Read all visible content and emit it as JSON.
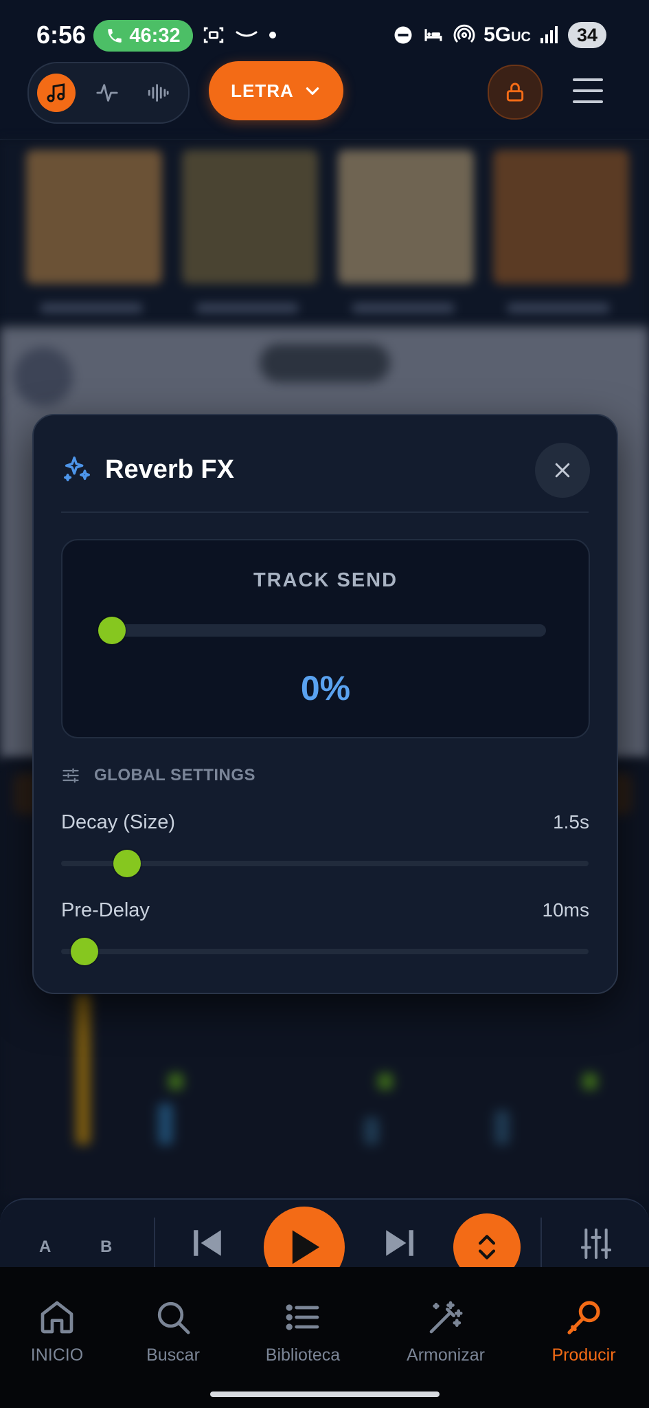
{
  "status_bar": {
    "time": "6:56",
    "call_timer": "46:32",
    "network": "5G",
    "network_suffix": "UC",
    "battery": "34"
  },
  "header": {
    "lyrics_button": "LETRA",
    "modes": [
      "music-note-icon",
      "waveform-line-icon",
      "audio-bars-icon"
    ],
    "active_mode": 0
  },
  "modal": {
    "title": "Reverb FX",
    "track_send": {
      "label": "TRACK SEND",
      "value_text": "0%",
      "level": 0
    },
    "global_settings": {
      "label": "GLOBAL SETTINGS",
      "params": [
        {
          "name": "Decay (Size)",
          "value_text": "1.5s",
          "level": 0.125
        },
        {
          "name": "Pre-Delay",
          "value_text": "10ms",
          "level": 0.045
        }
      ]
    }
  },
  "transport": {
    "a_label": "A",
    "b_label": "B"
  },
  "bottom_nav": {
    "items": [
      {
        "label": "INICIO",
        "icon": "home-icon"
      },
      {
        "label": "Buscar",
        "icon": "search-icon"
      },
      {
        "label": "Biblioteca",
        "icon": "list-icon"
      },
      {
        "label": "Armonizar",
        "icon": "magic-wand-icon"
      },
      {
        "label": "Producir",
        "icon": "microphone-icon"
      }
    ],
    "active_index": 4
  },
  "colors": {
    "accent": "#f36b16",
    "knob": "#86c71f",
    "value_blue": "#5aa2f0",
    "modal_bg": "#131c2e"
  }
}
